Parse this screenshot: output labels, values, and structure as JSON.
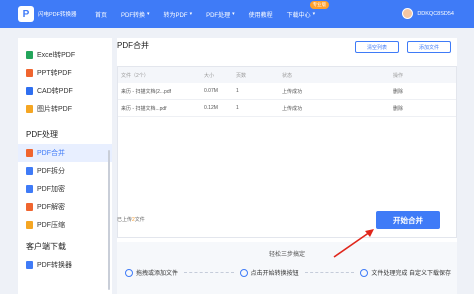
{
  "topbar": {
    "logo_text": "闪电PDF转换器",
    "nav": [
      {
        "label": "首页",
        "caret": false
      },
      {
        "label": "PDF转换",
        "caret": true
      },
      {
        "label": "转为PDF",
        "caret": true
      },
      {
        "label": "PDF处理",
        "caret": true
      },
      {
        "label": "使用教程",
        "caret": false
      },
      {
        "label": "下载中心",
        "caret": true,
        "badge": "专业版"
      }
    ],
    "user_id": "DDKQC8SD54",
    "color": "#3f7bf7"
  },
  "sidebar": {
    "convert_items": [
      {
        "label": "Excel转PDF",
        "icon": "excel-icon",
        "color": "#23a55b"
      },
      {
        "label": "PPT转PDF",
        "icon": "ppt-icon",
        "color": "#f0652f"
      },
      {
        "label": "CAD转PDF",
        "icon": "cad-icon",
        "color": "#2f6ff0"
      },
      {
        "label": "图片转PDF",
        "icon": "image-icon",
        "color": "#f5a623"
      }
    ],
    "section_process": "PDF处理",
    "process_items": [
      {
        "label": "PDF合并",
        "icon": "merge-icon",
        "color": "#f0652f",
        "active": true
      },
      {
        "label": "PDF拆分",
        "icon": "split-icon",
        "color": "#3f7bf7",
        "active": false
      },
      {
        "label": "PDF加密",
        "icon": "lock-icon",
        "color": "#3f7bf7",
        "active": false
      },
      {
        "label": "PDF解密",
        "icon": "unlock-icon",
        "color": "#f0652f",
        "active": false
      },
      {
        "label": "PDF压缩",
        "icon": "compress-icon",
        "color": "#f5a623",
        "active": false
      }
    ],
    "section_download": "客户端下载",
    "download_items": [
      {
        "label": "PDF转换器",
        "icon": "app-icon",
        "color": "#3f7bf7"
      }
    ]
  },
  "main": {
    "title": "PDF合并",
    "clear_button": "清空列表",
    "add_button": "添加文件",
    "table": {
      "headers": [
        "文件（2个）",
        "大小",
        "页数",
        "状态",
        "操作"
      ],
      "rows": [
        [
          "来历 - 扫描文档(2...pdf",
          "0.07M",
          "1",
          "上传成功",
          "删除"
        ],
        [
          "来历 - 扫描文档...pdf",
          "0.12M",
          "1",
          "上传成功",
          "删除"
        ]
      ]
    },
    "uploaded_prefix": "已上传",
    "uploaded_count": "2",
    "uploaded_suffix": "文件",
    "start_button": "开始合并",
    "steps_title": "轻松三步搞定",
    "steps": [
      "拖拽或添加文件",
      "点击开始转换按钮",
      "文件处理完成 自定义下载保存"
    ]
  }
}
